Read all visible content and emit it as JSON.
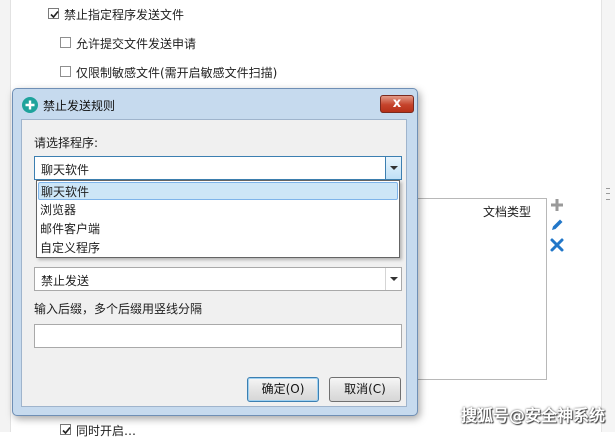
{
  "background": {
    "options": [
      {
        "label": "禁止指定程序发送文件",
        "checked": true
      },
      {
        "label": "允许提交文件发送申请",
        "checked": false
      },
      {
        "label": "仅限制敏感文件(需开启敏感文件扫描)",
        "checked": false
      }
    ],
    "table": {
      "column_header": "文档类型"
    },
    "side_icons": [
      "add-icon",
      "edit-icon",
      "delete-icon"
    ],
    "bottom_cut_label": "同时开启…"
  },
  "dialog": {
    "title": "禁止发送规则",
    "close_label": "x",
    "program_label": "请选择程序:",
    "program_selected": "聊天软件",
    "program_options": [
      "聊天软件",
      "浏览器",
      "邮件客户端",
      "自定义程序"
    ],
    "action_selected": "禁止发送",
    "suffix_label": "输入后缀，多个后缀用竖线分隔",
    "suffix_value": "",
    "ok_label": "确定(O)",
    "cancel_label": "取消(C)"
  },
  "watermark": "搜狐号@安全神系统",
  "colors": {
    "accent": "#3c7fb1",
    "dialog_frame": "#c6daee",
    "close": "#c5432b",
    "icon_blue": "#2277c8"
  }
}
